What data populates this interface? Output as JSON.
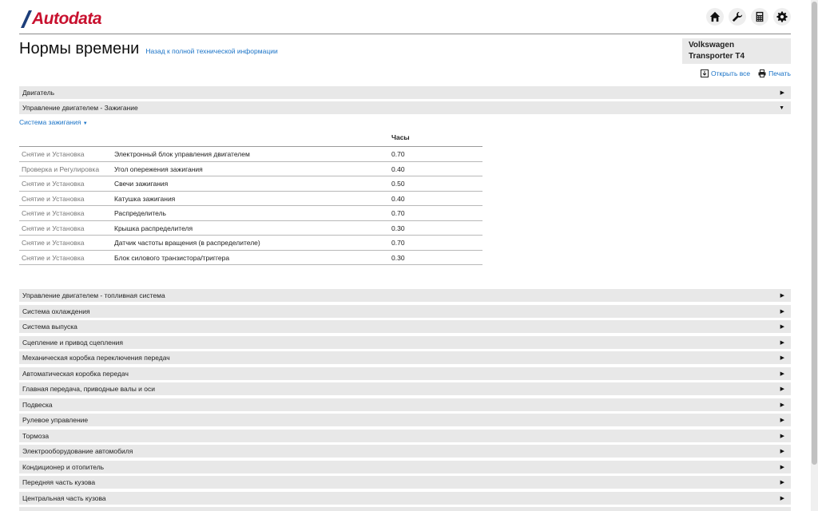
{
  "logo": {
    "text": "Autodata"
  },
  "header": {
    "icons": [
      "home-icon",
      "wrench-icon",
      "calculator-icon",
      "gear-icon"
    ]
  },
  "page": {
    "title": "Нормы времени",
    "back_link": "Назад к полной технической информации"
  },
  "vehicle": {
    "make": "Volkswagen",
    "model": "Transporter T4"
  },
  "actions": {
    "open_all": "Открыть все",
    "print": "Печать"
  },
  "sections_top": [
    {
      "label": "Двигатель",
      "expanded": false
    },
    {
      "label": "Управление двигателем - Зажигание",
      "expanded": true
    }
  ],
  "subsection": {
    "label": "Система зажигания"
  },
  "table": {
    "hours_header": "Часы",
    "rows": [
      {
        "operation": "Снятие и Установка",
        "component": "Электронный блок управления двигателем",
        "hours": "0.70"
      },
      {
        "operation": "Проверка и Регулировка",
        "component": "Угол опережения зажигания",
        "hours": "0.40"
      },
      {
        "operation": "Снятие и Установка",
        "component": "Свечи зажигания",
        "hours": "0.50"
      },
      {
        "operation": "Снятие и Установка",
        "component": "Катушка зажигания",
        "hours": "0.40"
      },
      {
        "operation": "Снятие и Установка",
        "component": "Распределитель",
        "hours": "0.70"
      },
      {
        "operation": "Снятие и Установка",
        "component": "Крышка распределителя",
        "hours": "0.30"
      },
      {
        "operation": "Снятие и Установка",
        "component": "Датчик частоты вращения (в распределителе)",
        "hours": "0.70"
      },
      {
        "operation": "Снятие и Установка",
        "component": "Блок силового транзистора/триггера",
        "hours": "0.30"
      }
    ]
  },
  "sections_bottom": [
    "Управление двигателем - топливная система",
    "Система охлаждения",
    "Система выпуска",
    "Сцепление и привод сцепления",
    "Механическая коробка переключения передач",
    "Автоматическая коробка передач",
    "Главная передача, приводные валы и оси",
    "Подвеска",
    "Рулевое управление",
    "Тормоза",
    "Электрооборудование автомобиля",
    "Кондиционер и отопитель",
    "Передняя часть кузова",
    "Центральная часть кузова"
  ],
  "colors": {
    "brand": "#c8102e",
    "link": "#1a73c7",
    "bar": "#e8e8e8"
  }
}
